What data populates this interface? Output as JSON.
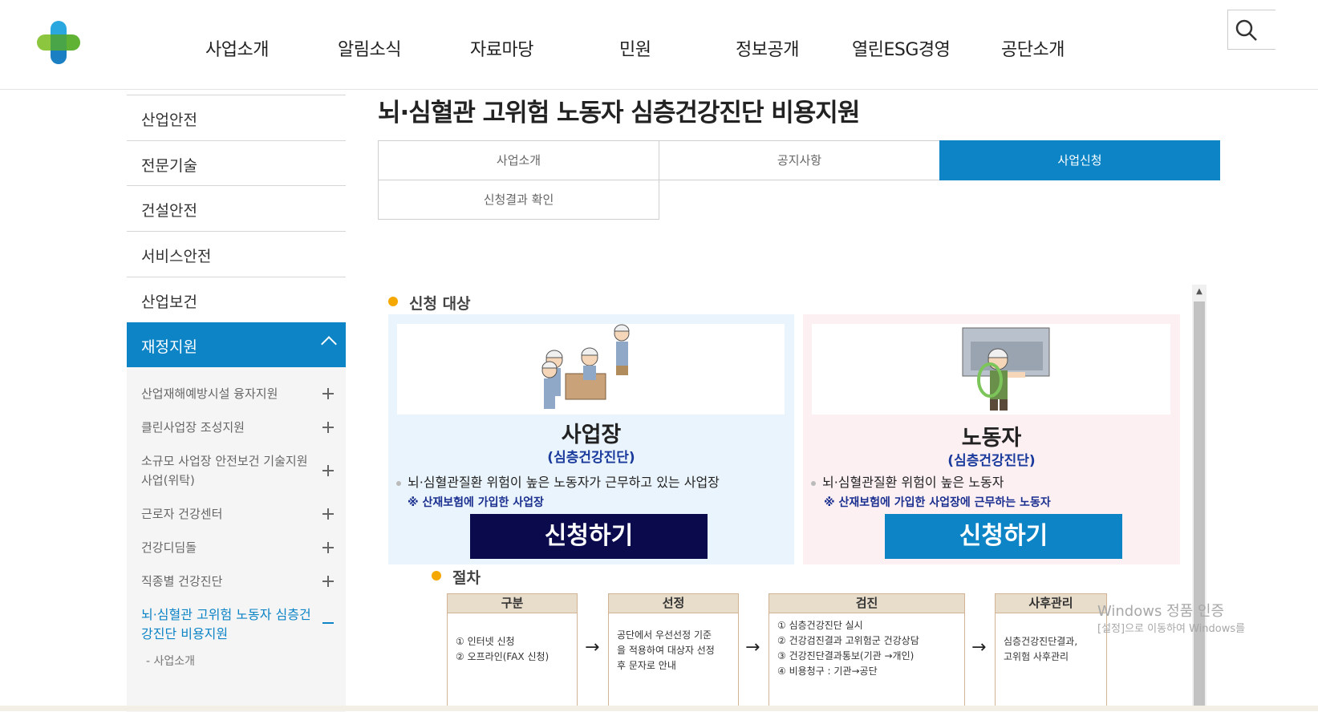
{
  "header": {
    "logo": "plus-cross-logo",
    "nav": [
      "사업소개",
      "알림소식",
      "자료마당",
      "민원",
      "정보공개",
      "열린ESG경영",
      "공단소개"
    ],
    "search_icon": "search-icon"
  },
  "sidebar": {
    "items": [
      "산업안전",
      "전문기술",
      "건설안전",
      "서비스안전",
      "산업보건"
    ],
    "active": "재정지원",
    "sub_items": [
      "산업재해예방시설 융자지원",
      "클린사업장 조성지원",
      "소규모 사업장 안전보건 기술지원사업(위탁)",
      "근로자 건강센터",
      "건강디딤돌",
      "직종별 건강진단"
    ],
    "current_sub": "뇌·심혈관 고위험 노동자 심층건강진단 비용지원",
    "current_sub_child": "- 사업소개"
  },
  "page": {
    "title": "뇌·심혈관 고위험 노동자 심층건강진단 비용지원"
  },
  "tabs": [
    "사업소개",
    "공지사항",
    "사업신청",
    "신청결과 확인"
  ],
  "section1": {
    "title": "신청 대상",
    "card_left": {
      "heading": "사업장",
      "sub": "(심층건강진단)",
      "desc": "뇌·심혈관질환 위험이 높은 노동자가 근무하고 있는 사업장",
      "note": "※ 산재보험에 가입한 사업장",
      "button": "신청하기"
    },
    "card_right": {
      "heading": "노동자",
      "sub": "(심층건강진단)",
      "desc": "뇌·심혈관질환 위험이 높은 노동자",
      "note": "※ 산재보험에 가입한 사업장에 근무하는 노동자",
      "button": "신청하기"
    }
  },
  "section2": {
    "title": "절차",
    "steps": [
      {
        "head": "구분",
        "lines": [
          "① 인터넷 신청",
          "② 오프라인(FAX 신청)"
        ]
      },
      {
        "head": "선정",
        "lines": [
          "공단에서 우선선정 기준",
          "을 적용하여 대상자 선정",
          "후 문자로 안내"
        ]
      },
      {
        "head": "검진",
        "lines": [
          "① 심층건강진단 실시",
          "② 건강검진결과 고위험군 건강상담",
          "③ 건강진단결과통보(기관 →개인)",
          "④ 비용청구 : 기관→공단"
        ]
      },
      {
        "head": "사후관리",
        "lines": [
          "심층건강진단결과,",
          "고위험 사후관리"
        ]
      }
    ],
    "arrow": "→"
  },
  "watermark": {
    "line1": "Windows 정품 인증",
    "line2": "[설정]으로 이동하여 Windows를"
  },
  "colors": {
    "primary": "#0c84c6",
    "navy_button": "#0a0a4c",
    "accent_dot": "#f5a800"
  }
}
